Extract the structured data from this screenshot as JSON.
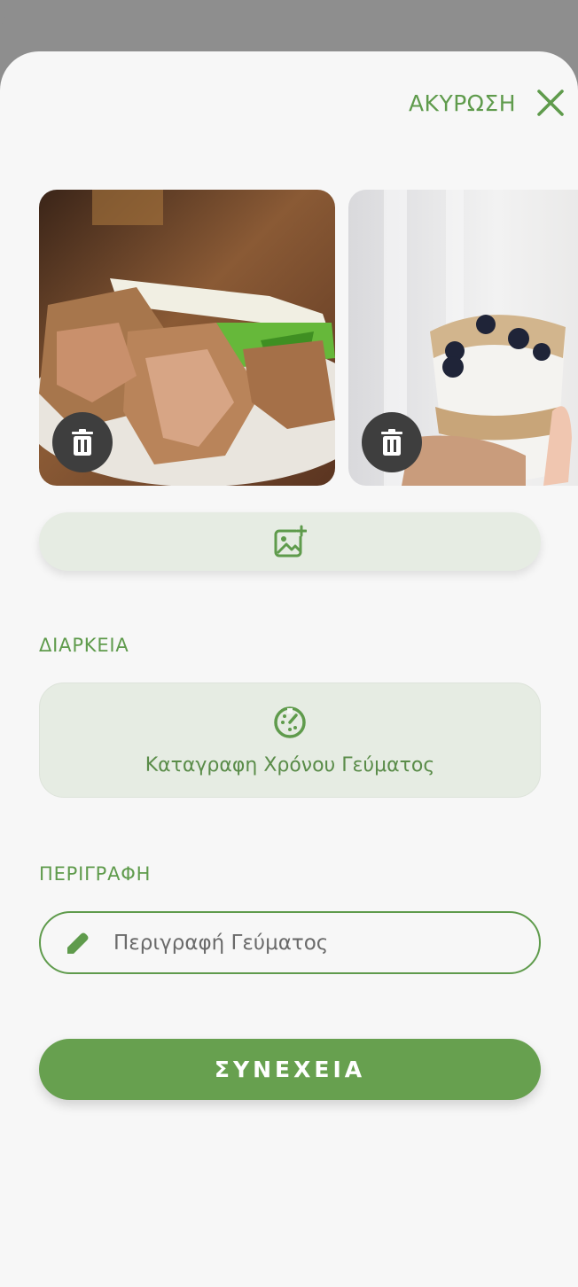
{
  "header": {
    "cancel_label": "ΑΚΥΡΩΣΗ",
    "close_icon": "close-icon"
  },
  "photos": [
    {
      "subject": "roasted meat slices with spring onions on a plate",
      "delete_icon": "trash-icon"
    },
    {
      "subject": "yogurt parfait with granola and blueberries in a glass",
      "delete_icon": "trash-icon"
    }
  ],
  "add_photo": {
    "icon": "add-photo-icon"
  },
  "duration": {
    "section_label": "ΔΙΑΡΚΕΙΑ",
    "icon": "timer-icon",
    "label": "Καταγραφη Χρόνου Γεύματος"
  },
  "description": {
    "section_label": "ΠΕΡΙΓΡΑΦΗ",
    "icon": "pencil-icon",
    "placeholder": "Περιγραφή Γεύματος",
    "value": ""
  },
  "continue_label": "ΣΥΝΕΧΕΙΑ",
  "colors": {
    "accent": "#67a04f",
    "accent_text": "#5f9b4c",
    "soft_fill": "#e6ece3",
    "background": "#f7f7f7",
    "overlay": "#8e8e8e"
  }
}
